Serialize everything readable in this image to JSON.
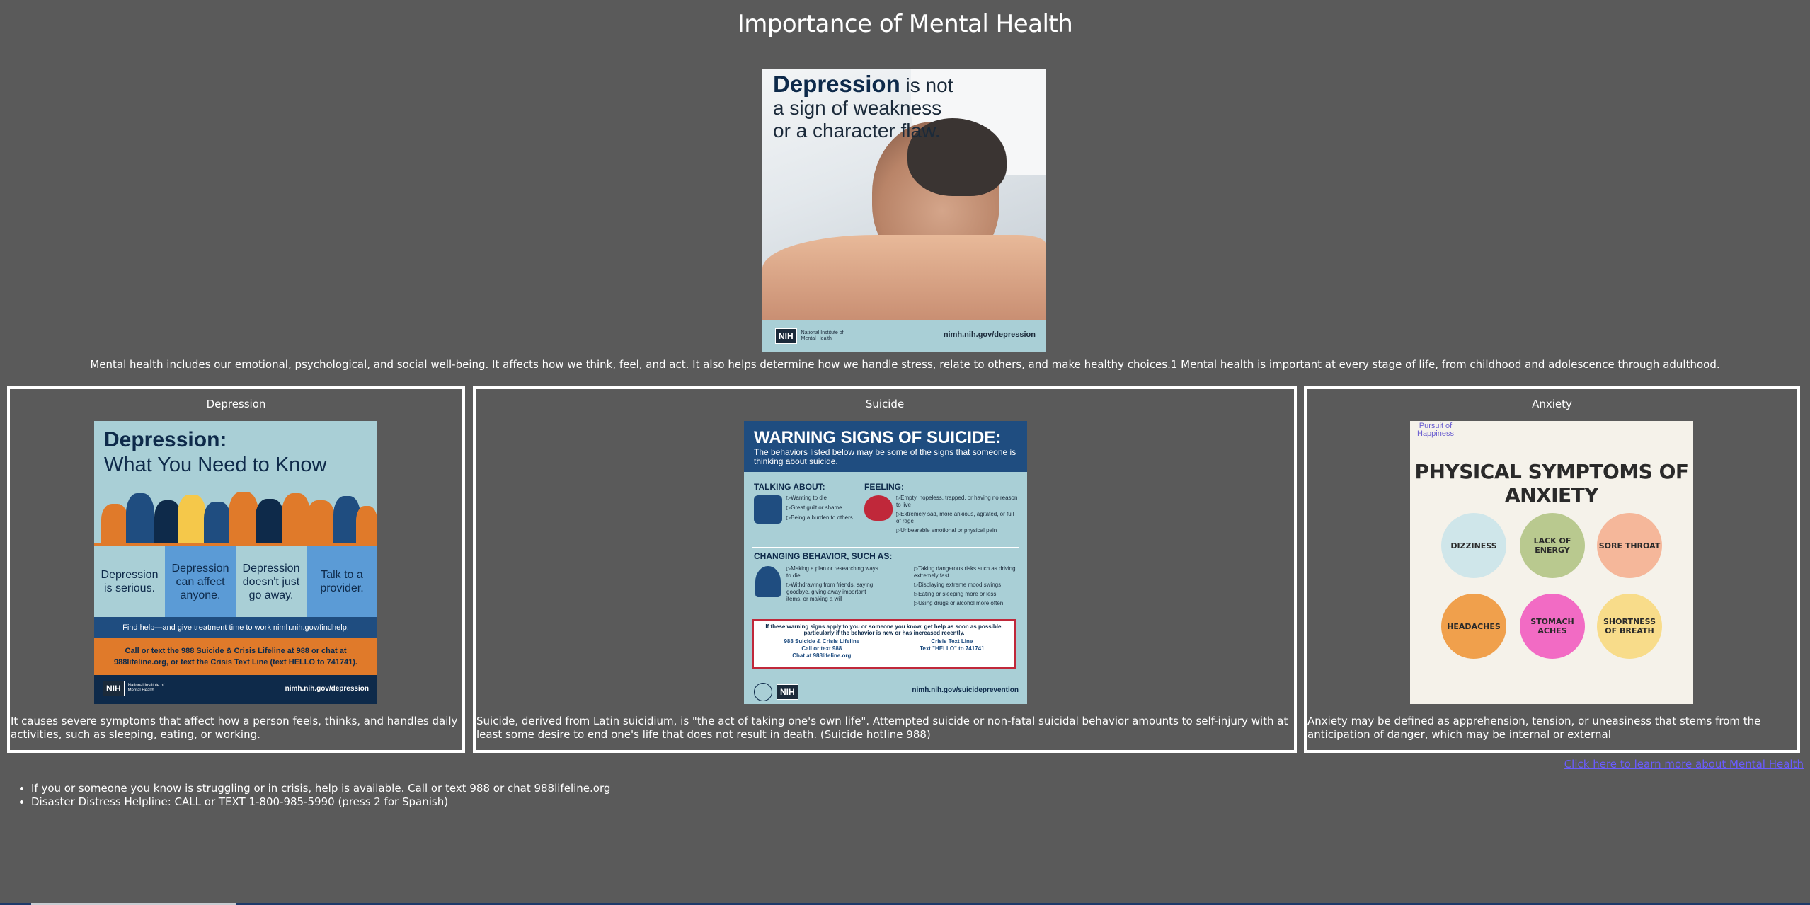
{
  "page": {
    "title": "Importance of Mental Health"
  },
  "hero": {
    "headline_bold": "Depression",
    "headline_rest": " is not a sign of weakness or a character flaw.",
    "logo": "NIH",
    "logo_org": "National Institute of Mental Health",
    "url": "nimh.nih.gov/depression"
  },
  "intro": "Mental health includes our emotional, psychological, and social well-being. It affects how we think, feel, and act. It also helps determine how we handle stress, relate to others, and make healthy choices.1 Mental health is important at every stage of life, from childhood and adolescence through adulthood.",
  "panels": {
    "depression": {
      "heading": "Depression",
      "poster": {
        "title1": "Depression:",
        "title2": "What You Need to Know",
        "cols": [
          "Depression is serious.",
          "Depression can affect anyone.",
          "Depression doesn't just go away.",
          "Talk to a provider."
        ],
        "findhelp": "Find help—and give treatment time to work nimh.nih.gov/findhelp.",
        "call": "Call or text the 988 Suicide & Crisis Lifeline at 988 or chat at 988lifeline.org, or text the Crisis Text Line (text HELLO to 741741).",
        "logo": "NIH",
        "logo_org": "National Institute of Mental Health",
        "url": "nimh.nih.gov/depression"
      },
      "description": "It causes severe symptoms that affect how a person feels, thinks, and handles daily activities, such as sleeping, eating, or working."
    },
    "suicide": {
      "heading": "Suicide",
      "poster": {
        "title": "WARNING SIGNS OF SUICIDE:",
        "subtitle": "The behaviors listed below may be some of the signs that someone is thinking about suicide.",
        "talking_heading": "TALKING ABOUT:",
        "talking": [
          "Wanting to die",
          "Great guilt or shame",
          "Being a burden to others"
        ],
        "feeling_heading": "FEELING:",
        "feeling": [
          "Empty, hopeless, trapped, or having no reason to live",
          "Extremely sad, more anxious, agitated, or full of rage",
          "Unbearable emotional or physical pain"
        ],
        "behavior_heading": "CHANGING BEHAVIOR, SUCH AS:",
        "behavior_left": [
          "Making a plan or researching ways to die",
          "Withdrawing from friends, saying goodbye, giving away important items, or making a will"
        ],
        "behavior_right": [
          "Taking dangerous risks such as driving extremely fast",
          "Displaying extreme mood swings",
          "Eating or sleeping more or less",
          "Using drugs or alcohol more often"
        ],
        "box_text": "If these warning signs apply to you or someone you know, get help as soon as possible, particularly if the behavior is new or has increased recently.",
        "lifeline_name": "988 Suicide & Crisis Lifeline",
        "lifeline_call": "Call or text 988",
        "lifeline_chat": "Chat at 988lifeline.org",
        "crisis_name": "Crisis Text Line",
        "crisis_text": "Text \"HELLO\" to 741741",
        "logo": "NIH",
        "url": "nimh.nih.gov/suicideprevention"
      },
      "description": "Suicide, derived from Latin suicidium, is \"the act of taking one's own life\". Attempted suicide or non-fatal suicidal behavior amounts to self-injury with at least some desire to end one's life that does not result in death. (Suicide hotline 988)"
    },
    "anxiety": {
      "heading": "Anxiety",
      "poster": {
        "brand": "Pursuit of Happiness",
        "title": "PHYSICAL SYMPTOMS OF ANXIETY",
        "symptoms": [
          {
            "label": "DIZZINESS",
            "color": "#cfe6ea"
          },
          {
            "label": "LACK OF ENERGY",
            "color": "#b9c98f"
          },
          {
            "label": "SORE THROAT",
            "color": "#f5b79a"
          },
          {
            "label": "HEADACHES",
            "color": "#f0a04c"
          },
          {
            "label": "STOMACH ACHES",
            "color": "#f26bc4"
          },
          {
            "label": "SHORTNESS OF BREATH",
            "color": "#f8dc8a"
          }
        ]
      },
      "description": "Anxiety may be defined as apprehension, tension, or uneasiness that stems from the anticipation of danger, which may be internal or external"
    }
  },
  "learn_link": "Click here to learn more about Mental Health",
  "help": [
    "If you or someone you know is struggling or in crisis, help is available. Call or text 988 or chat 988lifeline.org",
    "Disaster Distress Helpline: CALL or TEXT 1-800-985-5990 (press 2 for Spanish)"
  ]
}
